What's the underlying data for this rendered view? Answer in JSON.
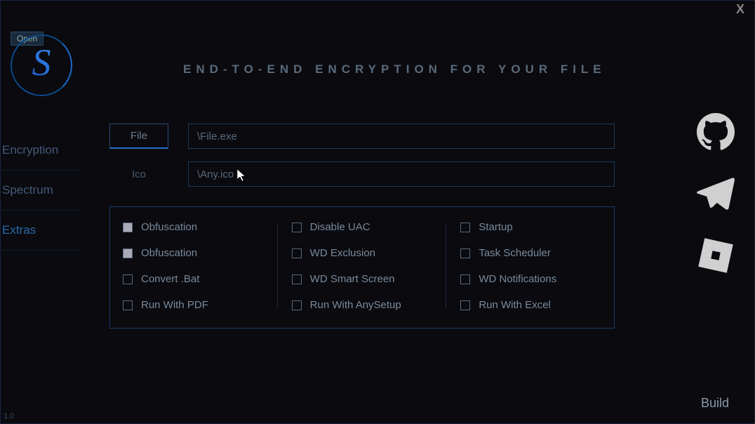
{
  "window": {
    "close_glyph": "X",
    "open_tag": "Open"
  },
  "headline": "END-TO-END ENCRYPTION FOR YOUR FILE",
  "sidebar": {
    "items": [
      {
        "label": "Encryption",
        "active": false
      },
      {
        "label": "Spectrum",
        "active": false
      },
      {
        "label": "Extras",
        "active": true
      }
    ]
  },
  "inputs": {
    "file_button": "File",
    "file_path": "\\File.exe",
    "ico_label": "Ico",
    "ico_path": "\\Any.ico"
  },
  "options": {
    "col1": [
      {
        "label": "Obfuscation",
        "checked": true
      },
      {
        "label": "Obfuscation",
        "checked": true
      },
      {
        "label": "Convert .Bat",
        "checked": false
      },
      {
        "label": "Run With PDF",
        "checked": false
      }
    ],
    "col2": [
      {
        "label": "Disable UAC",
        "checked": false
      },
      {
        "label": "WD Exclusion",
        "checked": false
      },
      {
        "label": "WD Smart Screen",
        "checked": false
      },
      {
        "label": "Run With AnySetup",
        "checked": false
      }
    ],
    "col3": [
      {
        "label": "Startup",
        "checked": false
      },
      {
        "label": "Task Scheduler",
        "checked": false
      },
      {
        "label": "WD Notifications",
        "checked": false
      },
      {
        "label": "Run With Excel",
        "checked": false
      }
    ]
  },
  "social": {
    "github": "github-icon",
    "telegram": "telegram-icon",
    "roblox": "roblox-icon"
  },
  "footer": {
    "build": "Build",
    "version": "1.0"
  }
}
